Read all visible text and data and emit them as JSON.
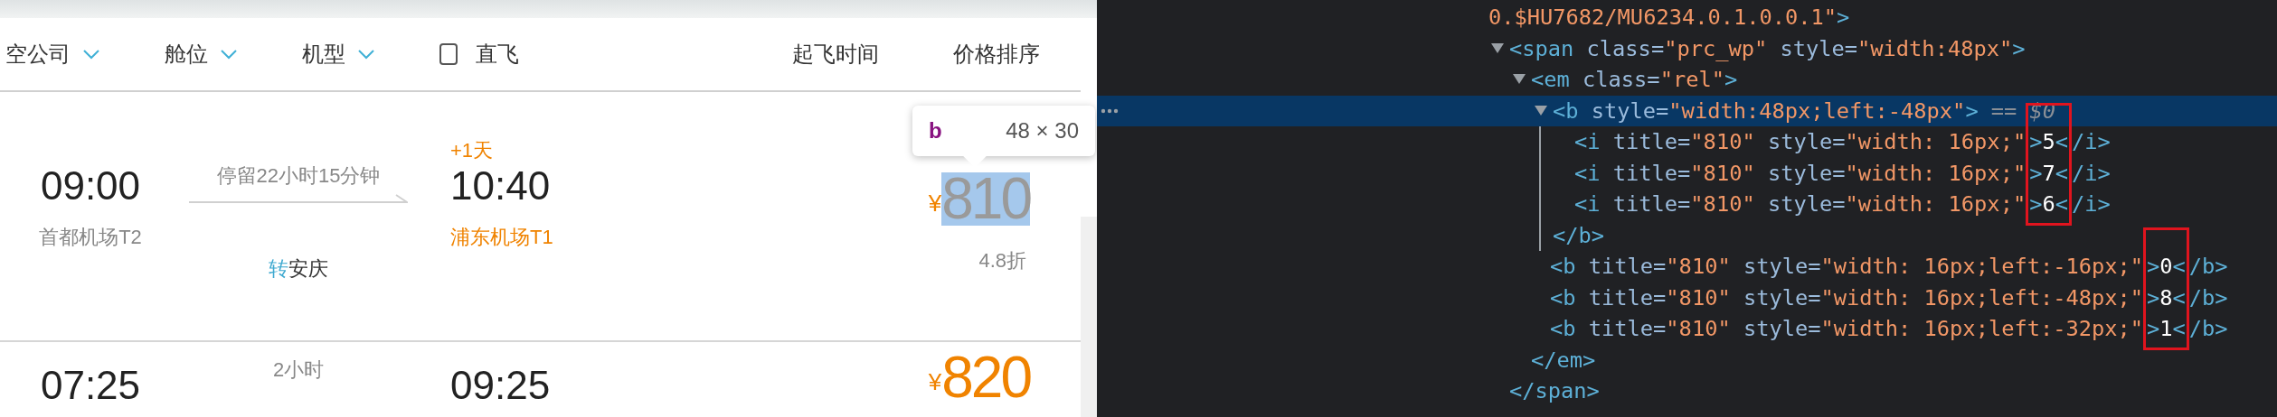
{
  "filters": [
    {
      "label": "空公司",
      "kind": "dropdown"
    },
    {
      "label": "舱位",
      "kind": "dropdown"
    },
    {
      "label": "机型",
      "kind": "dropdown"
    },
    {
      "label": "直飞",
      "kind": "checkbox",
      "checked": false
    }
  ],
  "sorts": [
    "起飞时间",
    "价格排序"
  ],
  "flights": [
    {
      "dep_time": "09:00",
      "dep_airport": "首都机场T2",
      "stop": "停留22小时15分钟",
      "via_prefix": "转",
      "via_city": "安庆",
      "next_day": "+1天",
      "arr_time": "10:40",
      "arr_airport": "浦东机场T1",
      "currency": "¥",
      "price": "810",
      "discount": "4.8折",
      "inspected": true,
      "tooltip": {
        "tag": "b",
        "size": "48 × 30"
      }
    },
    {
      "dep_time": "07:25",
      "duration": "2小时",
      "arr_time": "09:25",
      "currency": "¥",
      "price": "820",
      "inspected": false
    }
  ],
  "devtools": {
    "nodes": [
      {
        "kind": "line",
        "tokens": [
          {
            "kind": "value",
            "text": "0.$HU7682/MU6234.0.1.0.0.1\""
          },
          {
            "kind": "tag",
            "text": ">"
          }
        ]
      },
      {
        "kind": "element",
        "expanded": true,
        "selected": false,
        "open": [
          {
            "kind": "tag",
            "text": "<span"
          },
          {
            "kind": "attr",
            "text": " class="
          },
          {
            "kind": "value",
            "text": "\"prc_wp\""
          },
          {
            "kind": "attr",
            "text": " style="
          },
          {
            "kind": "value",
            "text": "\"width:48px\""
          },
          {
            "kind": "tag",
            "text": ">"
          }
        ],
        "close": [
          {
            "kind": "tag",
            "text": "</span>"
          }
        ],
        "children": [
          {
            "kind": "element",
            "expanded": true,
            "selected": false,
            "open": [
              {
                "kind": "tag",
                "text": "<em"
              },
              {
                "kind": "attr",
                "text": " class="
              },
              {
                "kind": "value",
                "text": "\"rel\""
              },
              {
                "kind": "tag",
                "text": ">"
              }
            ],
            "close": [
              {
                "kind": "tag",
                "text": "</em>"
              }
            ],
            "children": [
              {
                "kind": "element",
                "expanded": true,
                "selected": true,
                "open": [
                  {
                    "kind": "tag",
                    "text": "<b"
                  },
                  {
                    "kind": "attr",
                    "text": " style="
                  },
                  {
                    "kind": "value",
                    "text": "\"width:48px;left:-48px\""
                  },
                  {
                    "kind": "tag",
                    "text": ">"
                  }
                ],
                "marker": "== $0",
                "close": [
                  {
                    "kind": "tag",
                    "text": "</b>"
                  }
                ],
                "children": [
                  {
                    "kind": "framed",
                    "rows": [
                      {
                        "prefix": [
                          {
                            "kind": "tag",
                            "text": "<i"
                          },
                          {
                            "kind": "attr",
                            "text": " title="
                          },
                          {
                            "kind": "value",
                            "text": "\"810\""
                          },
                          {
                            "kind": "attr",
                            "text": " style="
                          },
                          {
                            "kind": "value",
                            "text": "\"width: 16px;\""
                          }
                        ],
                        "framed": [
                          {
                            "kind": "tag",
                            "text": ">"
                          },
                          {
                            "kind": "text",
                            "text": "5"
                          },
                          {
                            "kind": "tag",
                            "text": "<"
                          }
                        ],
                        "suffix": [
                          {
                            "kind": "tag",
                            "text": "/i>"
                          }
                        ]
                      },
                      {
                        "prefix": [
                          {
                            "kind": "tag",
                            "text": "<i"
                          },
                          {
                            "kind": "attr",
                            "text": " title="
                          },
                          {
                            "kind": "value",
                            "text": "\"810\""
                          },
                          {
                            "kind": "attr",
                            "text": " style="
                          },
                          {
                            "kind": "value",
                            "text": "\"width: 16px;\""
                          }
                        ],
                        "framed": [
                          {
                            "kind": "tag",
                            "text": ">"
                          },
                          {
                            "kind": "text",
                            "text": "7"
                          },
                          {
                            "kind": "tag",
                            "text": "<"
                          }
                        ],
                        "suffix": [
                          {
                            "kind": "tag",
                            "text": "/i>"
                          }
                        ]
                      },
                      {
                        "prefix": [
                          {
                            "kind": "tag",
                            "text": "<i"
                          },
                          {
                            "kind": "attr",
                            "text": " title="
                          },
                          {
                            "kind": "value",
                            "text": "\"810\""
                          },
                          {
                            "kind": "attr",
                            "text": " style="
                          },
                          {
                            "kind": "value",
                            "text": "\"width: 16px;\""
                          }
                        ],
                        "framed": [
                          {
                            "kind": "tag",
                            "text": ">"
                          },
                          {
                            "kind": "text",
                            "text": "6"
                          },
                          {
                            "kind": "tag",
                            "text": "<"
                          }
                        ],
                        "suffix": [
                          {
                            "kind": "tag",
                            "text": "/i>"
                          }
                        ]
                      }
                    ]
                  }
                ]
              },
              {
                "kind": "framed",
                "rows": [
                  {
                    "prefix": [
                      {
                        "kind": "tag",
                        "text": "<b"
                      },
                      {
                        "kind": "attr",
                        "text": " title="
                      },
                      {
                        "kind": "value",
                        "text": "\"810\""
                      },
                      {
                        "kind": "attr",
                        "text": " style="
                      },
                      {
                        "kind": "value",
                        "text": "\"width: 16px;left:-16px;\""
                      }
                    ],
                    "framed": [
                      {
                        "kind": "tag",
                        "text": ">"
                      },
                      {
                        "kind": "text",
                        "text": "0"
                      },
                      {
                        "kind": "tag",
                        "text": "<"
                      }
                    ],
                    "suffix": [
                      {
                        "kind": "tag",
                        "text": "/b>"
                      }
                    ]
                  },
                  {
                    "prefix": [
                      {
                        "kind": "tag",
                        "text": "<b"
                      },
                      {
                        "kind": "attr",
                        "text": " title="
                      },
                      {
                        "kind": "value",
                        "text": "\"810\""
                      },
                      {
                        "kind": "attr",
                        "text": " style="
                      },
                      {
                        "kind": "value",
                        "text": "\"width: 16px;left:-48px;\""
                      }
                    ],
                    "framed": [
                      {
                        "kind": "tag",
                        "text": ">"
                      },
                      {
                        "kind": "text",
                        "text": "8"
                      },
                      {
                        "kind": "tag",
                        "text": "<"
                      }
                    ],
                    "suffix": [
                      {
                        "kind": "tag",
                        "text": "/b>"
                      }
                    ]
                  },
                  {
                    "prefix": [
                      {
                        "kind": "tag",
                        "text": "<b"
                      },
                      {
                        "kind": "attr",
                        "text": " title="
                      },
                      {
                        "kind": "value",
                        "text": "\"810\""
                      },
                      {
                        "kind": "attr",
                        "text": " style="
                      },
                      {
                        "kind": "value",
                        "text": "\"width: 16px;left:-32px;\""
                      }
                    ],
                    "framed": [
                      {
                        "kind": "tag",
                        "text": ">"
                      },
                      {
                        "kind": "text",
                        "text": "1"
                      },
                      {
                        "kind": "tag",
                        "text": "<"
                      }
                    ],
                    "suffix": [
                      {
                        "kind": "tag",
                        "text": "/b>"
                      }
                    ]
                  }
                ]
              }
            ]
          }
        ]
      }
    ]
  }
}
